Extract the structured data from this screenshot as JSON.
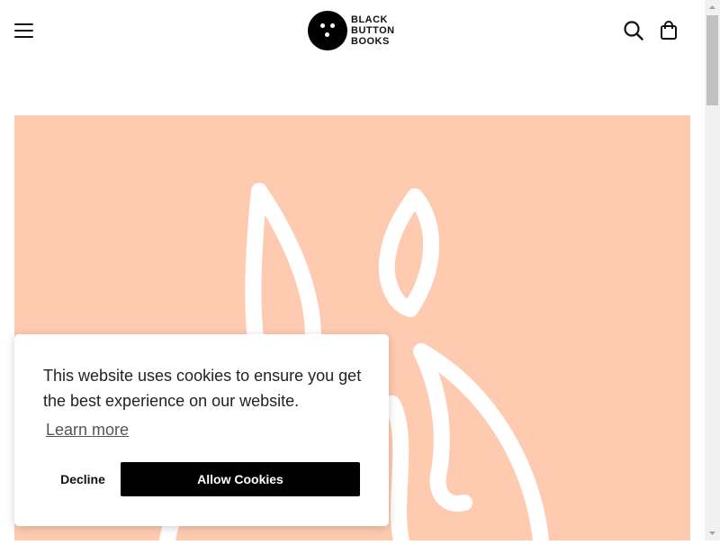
{
  "header": {
    "logo_lines": [
      "BLACK",
      "BUTTON",
      "BOOKS"
    ]
  },
  "icons": {
    "menu": "hamburger-icon",
    "search": "search-icon",
    "cart": "shopping-bag-icon"
  },
  "hero": {
    "background_color": "#fecbb1",
    "illustration": "flame-outline"
  },
  "cookie_banner": {
    "message": "This website uses cookies to ensure you get the best experience on our website.",
    "learn_more": "Learn more",
    "decline": "Decline",
    "allow": "Allow Cookies"
  }
}
